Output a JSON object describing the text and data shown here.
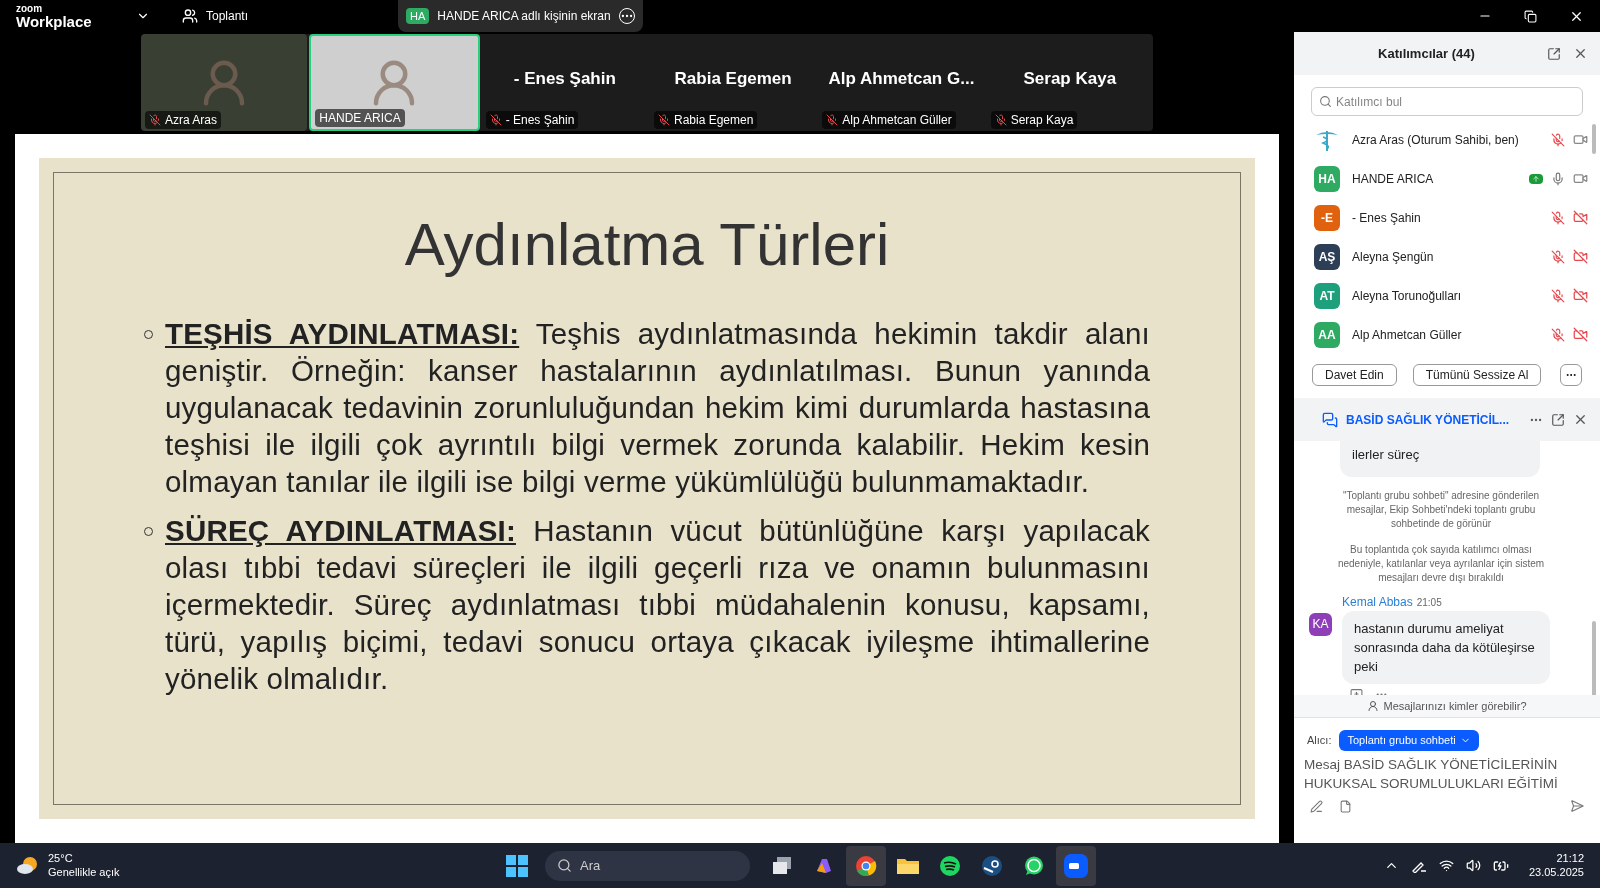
{
  "top_bar": {
    "logo_top": "zoom",
    "logo_bottom": "Workplace",
    "meeting_menu": "Toplantı",
    "share_banner": {
      "initials": "HA",
      "text": "HANDE ARICA adlı kişinin ekran"
    }
  },
  "video_strip": [
    {
      "kind": "video",
      "label": "Azra Aras",
      "muted": true,
      "active": false
    },
    {
      "kind": "video",
      "label": "HANDE ARICA",
      "muted": false,
      "active": true
    },
    {
      "kind": "name",
      "name": "- Enes Şahin",
      "label": "- Enes Şahin",
      "muted": true,
      "active": false
    },
    {
      "kind": "name",
      "name": "Rabia Egemen",
      "label": "Rabia Egemen",
      "muted": true,
      "active": false
    },
    {
      "kind": "name",
      "name": "Alp Ahmetcan G...",
      "label": "Alp Ahmetcan Güller",
      "muted": true,
      "active": false
    },
    {
      "kind": "name",
      "name": "Serap Kaya",
      "label": "Serap Kaya",
      "muted": true,
      "active": false
    }
  ],
  "slide": {
    "title": "Aydınlatma Türleri",
    "bullets": [
      {
        "heading": "TEŞHİS AYDINLATMASI:",
        "text": "Teşhis aydınlatmasında hekimin takdir alanı geniştir. Örneğin: kanser hastalarının aydınlatılması. Bunun yanında uygulanacak tedavinin zorunluluğundan hekim kimi durumlarda hastasına teşhisi ile ilgili çok ayrıntılı bilgi vermek zorunda kalabilir. Hekim kesin olmayan tanılar ile ilgili ise bilgi verme yükümlülüğü bulunmamaktadır."
      },
      {
        "heading": "SÜREÇ AYDINLATMASI:",
        "text": "Hastanın vücut bütünlüğüne karşı yapılacak olası tıbbi tedavi süreçleri ile ilgili geçerli rıza ve onamın bulunmasını içermektedir. Süreç aydınlatması tıbbi müdahalenin konusu, kapsamı, türü, yapılış biçimi, tedavi sonucu ortaya çıkacak  iyileşme ihtimallerine yönelik olmalıdır."
      }
    ]
  },
  "participants": {
    "title": "Katılımcılar (44)",
    "search": {
      "placeholder": "Katılımcı bul"
    },
    "rows": [
      {
        "kind": "logo",
        "name": "Azra Aras (Oturum Sahibi, ben)",
        "sharing": false,
        "mic_muted": true,
        "camera_off": false
      },
      {
        "kind": "initials",
        "initials": "HA",
        "color": "#2eaa62",
        "name": "HANDE ARICA",
        "sharing": true,
        "mic_muted": false,
        "camera_off": false
      },
      {
        "kind": "initials",
        "initials": "-E",
        "color": "#e0620f",
        "name": "- Enes Şahin",
        "sharing": false,
        "mic_muted": true,
        "camera_off": true
      },
      {
        "kind": "initials",
        "initials": "AŞ",
        "color": "#2d3e57",
        "name": "Aleyna Şengün",
        "sharing": false,
        "mic_muted": true,
        "camera_off": true
      },
      {
        "kind": "initials",
        "initials": "AT",
        "color": "#1fa07c",
        "name": "Aleyna Torunoğulları",
        "sharing": false,
        "mic_muted": true,
        "camera_off": true
      },
      {
        "kind": "initials",
        "initials": "AA",
        "color": "#2eaa62",
        "name": "Alp Ahmetcan Güller",
        "sharing": false,
        "mic_muted": true,
        "camera_off": true
      }
    ],
    "buttons": [
      "Davet Edin",
      "Tümünü Sessize Al"
    ]
  },
  "chat": {
    "title": "BASİD SAĞLIK YÖNETİCİL...",
    "partial_message": "ilerler süreç",
    "notices": [
      "\"Toplantı grubu sohbeti\" adresine gönderilen mesajlar, Ekip Sohbeti'ndeki toplantı grubu sohbetinde de görünür",
      "Bu toplantıda çok sayıda katılımcı olması nedeniyle, katılanlar veya ayrılanlar için sistem mesajları devre dışı bırakıldı"
    ],
    "message": {
      "initials": "KA",
      "author": "Kemal Abbas",
      "time": "21:05",
      "text": "hastanın durumu ameliyat sonrasında daha da kötüleşirse peki"
    },
    "visibility": "Mesajlarınızı kimler görebilir?",
    "recipient_label": "Alıcı:",
    "recipient": "Toplantı grubu sohbeti",
    "input": {
      "placeholder": "Mesaj BASİD SAĞLIK YÖNETİCİLERİNİN HUKUKSAL SORUMLULUKLARI EĞİTİMİ"
    }
  },
  "taskbar": {
    "temperature": "25°C",
    "weather": "Genellikle açık",
    "search": "Ara",
    "apps": [
      {
        "kind": "files-view",
        "active": false
      },
      {
        "kind": "copilot",
        "active": false
      },
      {
        "kind": "chrome",
        "active": true
      },
      {
        "kind": "folder",
        "active": false
      },
      {
        "kind": "spotify",
        "active": false
      },
      {
        "kind": "steam",
        "active": false
      },
      {
        "kind": "whatsapp",
        "active": false
      },
      {
        "kind": "zoom",
        "active": true
      }
    ],
    "time": "21:12",
    "date": "23.05.2025"
  }
}
